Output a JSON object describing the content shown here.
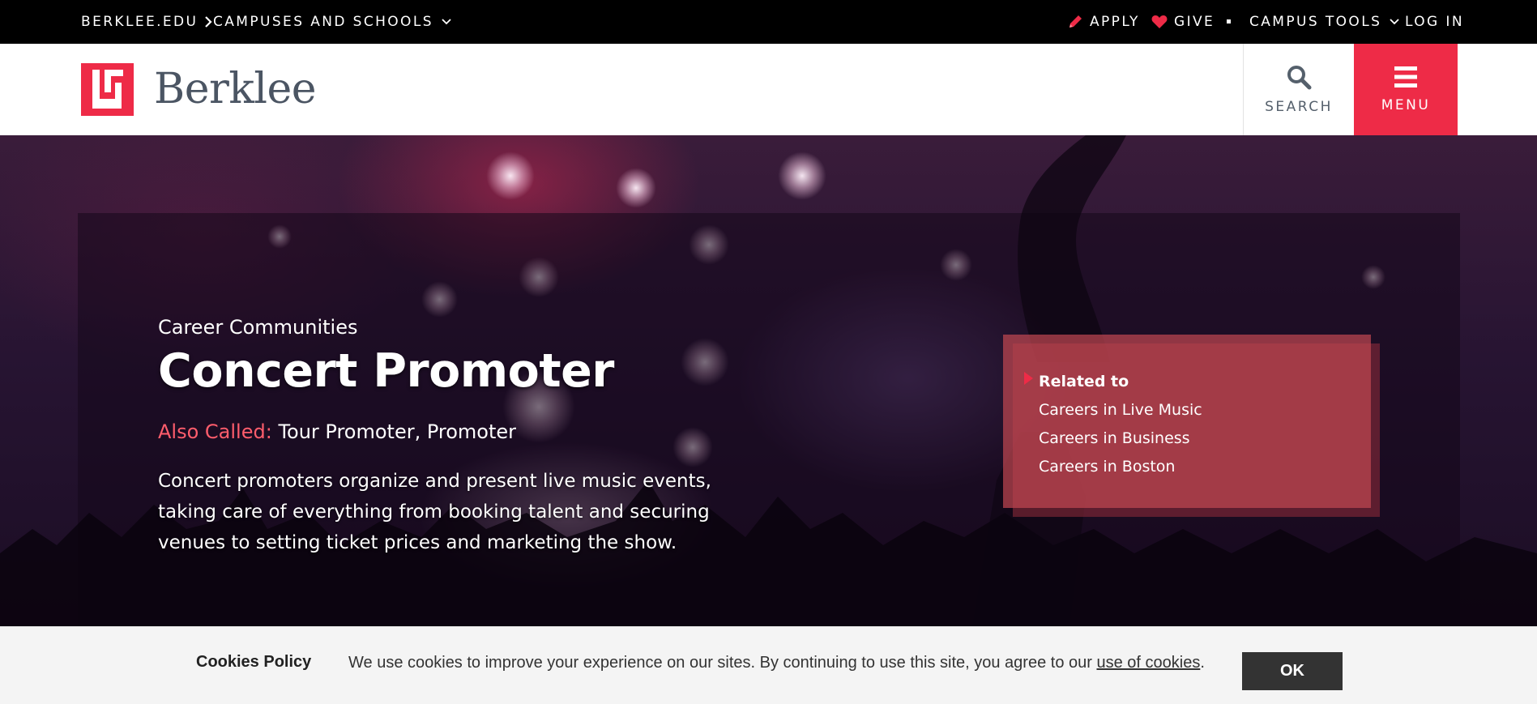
{
  "utility_bar": {
    "site_link": "BERKLEE.EDU",
    "campuses": "CAMPUSES AND SCHOOLS",
    "apply": "APPLY",
    "give": "GIVE",
    "campus_tools": "CAMPUS TOOLS",
    "log_in": "LOG IN",
    "icons": [
      "chevron-right-icon",
      "chevron-down-icon",
      "pencil-icon",
      "heart-icon",
      "chevron-down-icon"
    ],
    "accent_color": "#ee2b47"
  },
  "header": {
    "logo_text": "Berklee",
    "search_label": "SEARCH",
    "menu_label": "MENU",
    "icons": [
      "berklee-logo-icon",
      "search-icon",
      "hamburger-icon"
    ],
    "brand_color": "#ee2b47"
  },
  "hero": {
    "eyebrow": "Career Communities",
    "title": "Concert Promoter",
    "also_called_label": "Also Called:",
    "also_called_value": "Tour Promoter, Promoter",
    "description": "Concert promoters organize and present live music events, taking care of everything from booking talent and securing venues to setting ticket prices and marketing the show.",
    "related": {
      "heading": "Related to",
      "links": [
        "Careers in Live Music",
        "Careers in Business",
        "Careers in Boston"
      ]
    }
  },
  "cookie_bar": {
    "title": "Cookies Policy",
    "text_before": "We use cookies to improve your experience on our sites. By continuing to use this site, you agree to our ",
    "link": "use of cookies",
    "text_after": ".",
    "ok_label": "OK"
  }
}
